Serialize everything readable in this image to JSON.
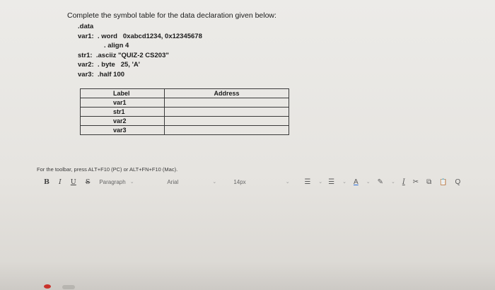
{
  "question": {
    "text": "Complete the symbol table for the data declaration given below:"
  },
  "code_lines": [
    ".data",
    "var1:  . word   0xabcd1234, 0x12345678",
    "              . align 4",
    "str1:  .asciiz \"QUIZ-2 CS203\"",
    "var2:  . byte   25, 'A'",
    "var3:  .half 100"
  ],
  "table": {
    "headers": {
      "label": "Label",
      "address": "Address"
    },
    "rows": [
      {
        "label": "var1",
        "address": ""
      },
      {
        "label": "str1",
        "address": ""
      },
      {
        "label": "var2",
        "address": ""
      },
      {
        "label": "var3",
        "address": ""
      }
    ]
  },
  "editor": {
    "hint": "For the toolbar, press ALT+F10 (PC) or ALT+FN+F10 (Mac).",
    "toolbar": {
      "bold": "B",
      "italic": "I",
      "underline": "U",
      "strikethrough": "S",
      "paragraph": "Paragraph",
      "font": "Arial",
      "size": "14px",
      "text_color": "A",
      "clear_format": "I",
      "cut": "✂",
      "copy": "⧉",
      "paste": "📋",
      "search": "Q"
    }
  }
}
